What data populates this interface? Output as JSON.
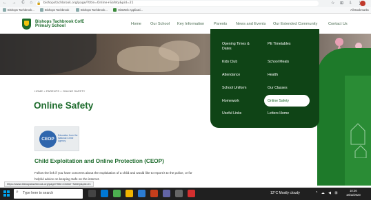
{
  "browser": {
    "address": "bishopstachbrook.org/page/?title=Online+Safety&pid=21",
    "bookmarks": [
      "Bishops Tachbrook...",
      "Bishops Tachbrook",
      "Bishops Tachbrook...",
      "HitsWeb Applicati..."
    ],
    "bookmarks_right": "All Bookmarks"
  },
  "header": {
    "school_name": "Bishops Tachbrook CofE Primary School",
    "nav": [
      "Home",
      "Our School",
      "Key Information",
      "Parents",
      "News and Events",
      "Our Extended Community",
      "Contact Us"
    ]
  },
  "dropdown": {
    "left_column": [
      "Opening Times & Dates",
      "Kids Club",
      "Attendance",
      "School Uniform",
      "Homework",
      "Useful Links"
    ],
    "right_column": [
      "PE Timetables",
      "School Meals",
      "Health",
      "Our Classes",
      "Online Safety",
      "Letters Home"
    ],
    "active": "Online Safety"
  },
  "side_menu": [
    "School Meals",
    "Attendance",
    "Health",
    "School Uniform"
  ],
  "main": {
    "breadcrumb": [
      "HOME",
      "PARENTS",
      "ONLINE SAFETY"
    ],
    "title": "Online Safety",
    "ceop_logo_text": "CEOP",
    "ceop_tagline": "Education from the National Crime Agency",
    "section_heading": "Child Exploitation and Online Protection (CEOP)",
    "body": "Follow the link if you have concerns about the exploitation of a child and would like to report it to the police, or for helpful advice on keeping Safe on the internet."
  },
  "status_url": "https://www.bishopstachbrook.org/page/?title=Online+Safety&pid=21",
  "taskbar": {
    "search_placeholder": "Type here to search",
    "weather": "12°C  Mostly cloudy",
    "time": "10:26",
    "date": "18/11/2023"
  },
  "colors": {
    "brand_green": "#1d6b2c",
    "dropdown_bg": "#0f4416",
    "side_green": "#1e7a2a"
  }
}
